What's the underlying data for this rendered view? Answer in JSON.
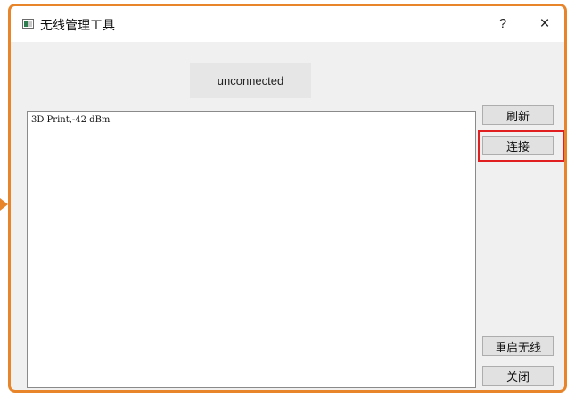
{
  "window": {
    "title": "无线管理工具",
    "help_label": "?",
    "close_label": "×"
  },
  "status": {
    "text": "unconnected"
  },
  "networks": [
    "3D Print,-42 dBm"
  ],
  "buttons": {
    "refresh": "刷新",
    "connect": "连接",
    "restart_wireless": "重启无线",
    "close": "关闭"
  },
  "colors": {
    "frame_accent": "#e8852a",
    "highlight": "#e02020"
  }
}
